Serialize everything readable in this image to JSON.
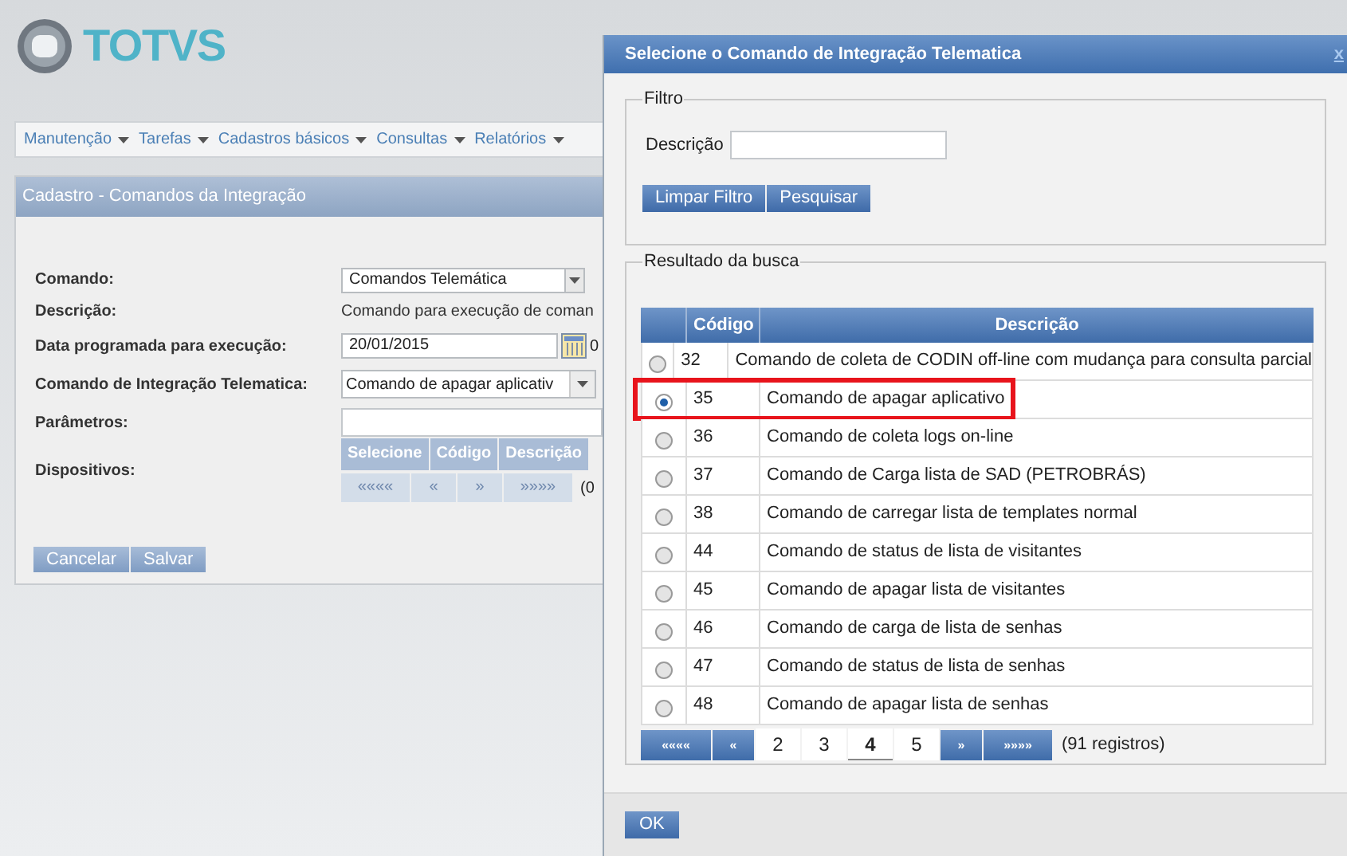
{
  "logo": {
    "text": "TOTVS"
  },
  "menu": [
    {
      "label": "Manutenção"
    },
    {
      "label": "Tarefas"
    },
    {
      "label": "Cadastros básicos"
    },
    {
      "label": "Consultas"
    },
    {
      "label": "Relatórios"
    }
  ],
  "panel": {
    "title": "Cadastro - Comandos da Integração",
    "fields": [
      {
        "kind": "select",
        "label": "Comando:",
        "value": "Comandos Telemática"
      },
      {
        "kind": "text",
        "label": "Descrição:",
        "value": "Comando para execução de coman"
      },
      {
        "kind": "date",
        "label": "Data programada para execução:",
        "value": "20/01/2015",
        "suffix": "0"
      },
      {
        "kind": "combo",
        "label": "Comando de Integração Telematica:",
        "value": "Comando de apagar aplicativ"
      },
      {
        "kind": "input",
        "label": "Parâmetros:"
      },
      {
        "kind": "devices",
        "label": "Dispositivos:",
        "columns": [
          "Selecione",
          "Código",
          "Descrição"
        ],
        "pager": [
          "««««",
          "«",
          "»",
          "»»»»"
        ],
        "count": "(0"
      }
    ],
    "buttons": [
      "Cancelar",
      "Salvar"
    ]
  },
  "dialog": {
    "title": "Selecione o Comando de Integração Telematica",
    "close": "x",
    "filter": {
      "legend": "Filtro",
      "label": "Descrição",
      "buttons": [
        "Limpar Filtro",
        "Pesquisar"
      ]
    },
    "results": {
      "legend": "Resultado da busca",
      "columns": [
        "Código",
        "Descrição"
      ],
      "rows": [
        {
          "code": "32",
          "description": "Comando de coleta de CODIN off-line com mudança para consulta parcial",
          "selected": false,
          "highlighted": false
        },
        {
          "code": "35",
          "description": "Comando de apagar aplicativo",
          "selected": true,
          "highlighted": true
        },
        {
          "code": "36",
          "description": "Comando de coleta logs on-line",
          "selected": false,
          "highlighted": false
        },
        {
          "code": "37",
          "description": "Comando de Carga lista de SAD (PETROBRÁS)",
          "selected": false,
          "highlighted": false
        },
        {
          "code": "38",
          "description": "Comando de carregar lista de templates normal",
          "selected": false,
          "highlighted": false
        },
        {
          "code": "44",
          "description": "Comando de status de lista de visitantes",
          "selected": false,
          "highlighted": false
        },
        {
          "code": "45",
          "description": "Comando de apagar lista de visitantes",
          "selected": false,
          "highlighted": false
        },
        {
          "code": "46",
          "description": "Comando de carga de lista de senhas",
          "selected": false,
          "highlighted": false
        },
        {
          "code": "47",
          "description": "Comando de status de lista de senhas",
          "selected": false,
          "highlighted": false
        },
        {
          "code": "48",
          "description": "Comando de apagar lista de senhas",
          "selected": false,
          "highlighted": false
        }
      ],
      "pager": [
        {
          "label": "««««",
          "kind": "nav"
        },
        {
          "label": "«",
          "kind": "nav"
        },
        {
          "label": "2",
          "kind": "page",
          "selected": false
        },
        {
          "label": "3",
          "kind": "page",
          "selected": false
        },
        {
          "label": "4",
          "kind": "page",
          "selected": true
        },
        {
          "label": "5",
          "kind": "page",
          "selected": false
        },
        {
          "label": "»",
          "kind": "nav"
        },
        {
          "label": "»»»»",
          "kind": "nav"
        }
      ],
      "count": "(91 registros)"
    },
    "ok": "OK"
  }
}
